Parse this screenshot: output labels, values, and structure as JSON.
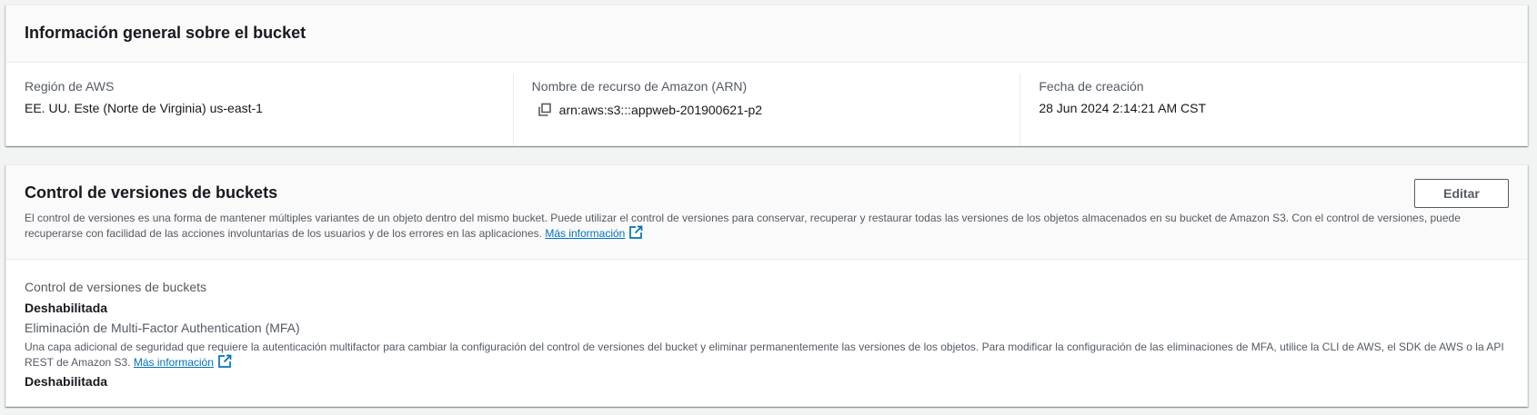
{
  "overview": {
    "title": "Información general sobre el bucket",
    "region_label": "Región de AWS",
    "region_value": "EE. UU. Este (Norte de Virginia) us-east-1",
    "arn_label": "Nombre de recurso de Amazon (ARN)",
    "arn_value": "arn:aws:s3:::appweb-201900621-p2",
    "created_label": "Fecha de creación",
    "created_value": "28 Jun 2024 2:14:21 AM CST"
  },
  "versioning": {
    "title": "Control de versiones de buckets",
    "edit_label": "Editar",
    "description": "El control de versiones es una forma de mantener múltiples variantes de un objeto dentro del mismo bucket. Puede utilizar el control de versiones para conservar, recuperar y restaurar todas las versiones de los objetos almacenados en su bucket de Amazon S3. Con el control de versiones, puede recuperarse con facilidad de las acciones involuntarias de los usuarios y de los errores en las aplicaciones.",
    "more_info_label": "Más información",
    "status_label": "Control de versiones de buckets",
    "status_value": "Deshabilitada",
    "mfa_label": "Eliminación de Multi-Factor Authentication (MFA)",
    "mfa_description": "Una capa adicional de seguridad que requiere la autenticación multifactor para cambiar la configuración del control de versiones del bucket y eliminar permanentemente las versiones de los objetos. Para modificar la configuración de las eliminaciones de MFA, utilice la CLI de AWS, el SDK de AWS o la API REST de Amazon S3.",
    "mfa_more_info_label": "Más información",
    "mfa_value": "Deshabilitada"
  },
  "colors": {
    "link": "#0073bb",
    "text": "#16191f",
    "secondary_text": "#545b64",
    "page_background": "#f2f3f3"
  },
  "icons": [
    "copy-icon",
    "external-link-icon"
  ]
}
